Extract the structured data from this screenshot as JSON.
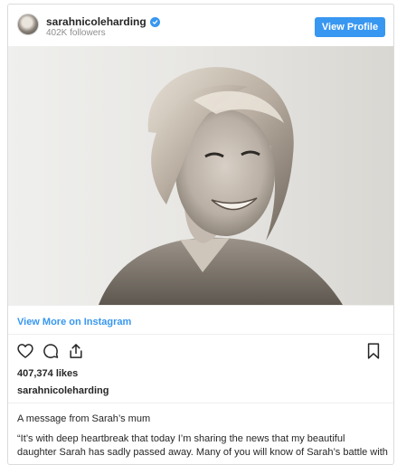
{
  "header": {
    "username": "sarahnicoleharding",
    "followers": "402K followers",
    "view_profile_label": "View Profile"
  },
  "photo": {
    "description_icon": "portrait-photo"
  },
  "links": {
    "view_more": "View More on Instagram"
  },
  "actions": {
    "icons": [
      "heart-icon",
      "comment-icon",
      "share-icon",
      "bookmark-icon"
    ]
  },
  "post": {
    "likes": "407,374 likes",
    "caption_user": "sarahnicoleharding",
    "caption_title": "A message from Sarah’s mum",
    "caption_line1": "“It’s with deep heartbreak that today I’m sharing the news that my beautiful",
    "caption_line2": "daughter Sarah has sadly passed away. Many of you will know of Sarah’s battle with"
  },
  "colors": {
    "accent": "#3897f0",
    "text": "#262626",
    "muted": "#8e8e8e"
  }
}
